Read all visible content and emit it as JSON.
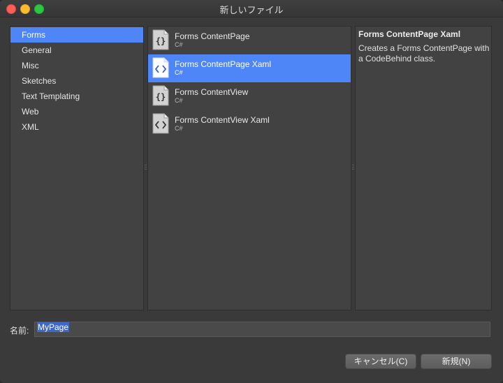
{
  "window": {
    "title": "新しいファイル"
  },
  "categories": [
    {
      "label": "Forms",
      "selected": true
    },
    {
      "label": "General",
      "selected": false
    },
    {
      "label": "Misc",
      "selected": false
    },
    {
      "label": "Sketches",
      "selected": false
    },
    {
      "label": "Text Templating",
      "selected": false
    },
    {
      "label": "Web",
      "selected": false
    },
    {
      "label": "XML",
      "selected": false
    }
  ],
  "templates": [
    {
      "name": "Forms ContentPage",
      "lang": "C#",
      "icon": "braces-file-icon",
      "selected": false
    },
    {
      "name": "Forms ContentPage Xaml",
      "lang": "C#",
      "icon": "angle-brackets-file-icon",
      "selected": true
    },
    {
      "name": "Forms ContentView",
      "lang": "C#",
      "icon": "braces-file-icon",
      "selected": false
    },
    {
      "name": "Forms ContentView Xaml",
      "lang": "C#",
      "icon": "angle-brackets-file-icon",
      "selected": false
    }
  ],
  "description": {
    "title": "Forms ContentPage Xaml",
    "body": "Creates a Forms ContentPage with a CodeBehind class."
  },
  "name_field": {
    "label": "名前:",
    "value": "MyPage"
  },
  "buttons": {
    "cancel": "キャンセル(C)",
    "new": "新規(N)"
  },
  "colors": {
    "selection": "#4f86f7",
    "pane_bg": "#424242",
    "window_bg": "#3a3a3a"
  }
}
